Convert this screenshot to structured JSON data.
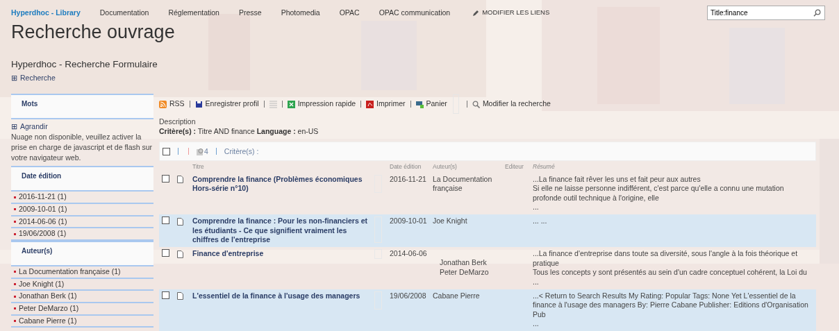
{
  "topnav": {
    "brand": "Hyperdhoc - Library",
    "links": [
      "Documentation",
      "Réglementation",
      "Presse",
      "Photomedia",
      "OPAC",
      "OPAC communication"
    ],
    "edit_links": "MODIFIER LES LIENS"
  },
  "search": {
    "value": "Title:finance"
  },
  "page_title": "Recherche ouvrage",
  "form_title": "Hyperdhoc - Recherche Formulaire",
  "search_toggle": {
    "symbol": "⊞",
    "label": "Recherche"
  },
  "sidebar": {
    "sections": [
      {
        "heading": "Mots",
        "expand": {
          "symbol": "⊞",
          "label": "Agrandir"
        },
        "note": "Nuage non disponible, veuillez activer la prise en charge de javascript et de flash sur votre navigateur web."
      },
      {
        "heading": "Date édition",
        "items": [
          "2016-11-21 (1)",
          "2009-10-01 (1)",
          "2014-06-06 (1)",
          "19/06/2008 (1)"
        ]
      },
      {
        "heading": "Auteur(s)",
        "items": [
          "La Documentation française (1)",
          "Joe Knight (1)",
          "Jonathan Berk (1)",
          "Peter DeMarzo (1)",
          "Cabane Pierre (1)"
        ]
      }
    ]
  },
  "toolbar": [
    {
      "kind": "rss",
      "label": "RSS"
    },
    {
      "kind": "save",
      "label": "Enregistrer profil"
    },
    {
      "kind": "list"
    },
    {
      "kind": "excel",
      "label": "Impression rapide"
    },
    {
      "kind": "pdf",
      "label": "Imprimer"
    },
    {
      "kind": "cart",
      "label": "Panier"
    },
    {
      "kind": "blank"
    },
    {
      "kind": "search",
      "label": "Modifier la recherche"
    }
  ],
  "description": {
    "label": "Description",
    "criteria_label": "Critère(s) :",
    "criteria": "Titre AND finance",
    "language_label": "Language :",
    "language": "en-US"
  },
  "results_bar": {
    "count": "4",
    "criteria_label": "Critère(s) :",
    "checked": false
  },
  "table": {
    "columns": [
      "Titre",
      "Date édition",
      "Auteur(s)",
      "Editeur",
      "Résumé"
    ],
    "rows": [
      {
        "checked": false,
        "title": "Comprendre la finance (Problèmes économiques Hors-série n°10)",
        "date": "2016-11-21",
        "authors": [
          "La Documentation française"
        ],
        "summary": [
          "...La finance fait rêver les uns et fait peur aux autres",
          "Si elle ne laisse personne indifférent, c'est parce qu'elle a connu une mutation profonde outil technique à l'origine, elle",
          "..."
        ]
      },
      {
        "checked": false,
        "title": "Comprendre la finance : Pour les non-financiers et les étudiants - Ce que signifient vraiment les chiffres de l'entreprise",
        "date": "2009-10-01",
        "authors": [
          "Joe Knight"
        ],
        "summary": [
          "... ..."
        ]
      },
      {
        "checked": false,
        "title": "Finance d'entreprise",
        "date": "2014-06-06",
        "authors": [
          "Jonathan Berk",
          "Peter DeMarzo"
        ],
        "summary": [
          "...La finance d'entreprise dans toute sa diversité, sous l'angle à la fois théorique et pratique",
          "Tous les concepts y sont présentés au sein d'un cadre conceptuel cohérent, la Loi du",
          "..."
        ]
      },
      {
        "checked": false,
        "title": "L'essentiel de la finance à l'usage des managers",
        "date": "19/06/2008",
        "authors": [
          "Cabane Pierre"
        ],
        "summary": [
          "...< Return to Search Results My Rating: Popular Tags: None Yet L'essentiel de la finance à l'usage des managers By: Pierre Cabane Publisher: Editions d'Organisation Pub",
          "..."
        ]
      }
    ]
  }
}
